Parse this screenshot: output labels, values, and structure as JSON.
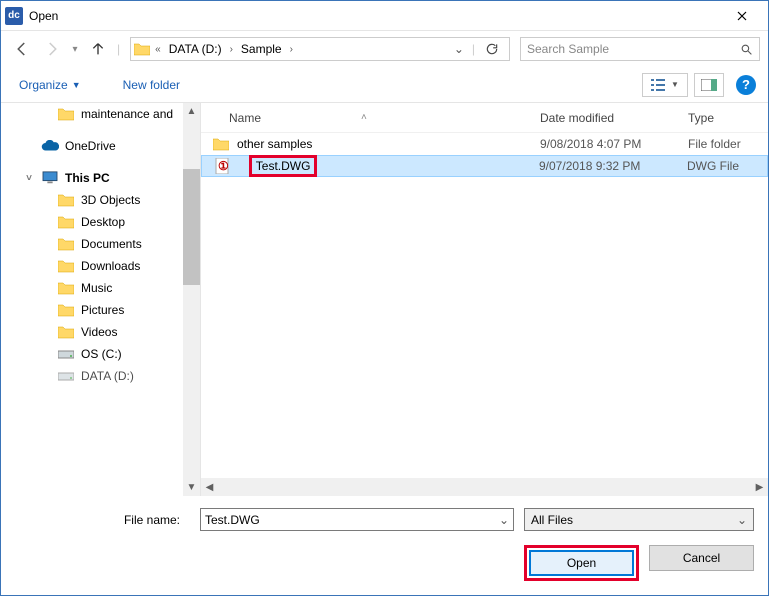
{
  "dialog": {
    "title": "Open",
    "app_icon_label": "dc"
  },
  "breadcrumb": {
    "prefix": "«",
    "items": [
      "DATA (D:)",
      "Sample"
    ]
  },
  "search": {
    "placeholder": "Search Sample"
  },
  "toolbar": {
    "organize": "Organize",
    "new_folder": "New folder"
  },
  "tree": {
    "items": [
      {
        "name": "maintenance and",
        "icon": "folder",
        "indent": 2
      },
      {
        "name": "",
        "icon": "",
        "indent": 0,
        "spacer": true
      },
      {
        "name": "OneDrive",
        "icon": "onedrive",
        "indent": 1,
        "bold": false,
        "expander": " "
      },
      {
        "name": "",
        "icon": "",
        "indent": 0,
        "spacer": true
      },
      {
        "name": "This PC",
        "icon": "thispc",
        "indent": 1,
        "bold": true,
        "expander": "v"
      },
      {
        "name": "3D Objects",
        "icon": "folder",
        "indent": 2
      },
      {
        "name": "Desktop",
        "icon": "folder",
        "indent": 2
      },
      {
        "name": "Documents",
        "icon": "folder",
        "indent": 2
      },
      {
        "name": "Downloads",
        "icon": "folder",
        "indent": 2
      },
      {
        "name": "Music",
        "icon": "folder",
        "indent": 2
      },
      {
        "name": "Pictures",
        "icon": "folder",
        "indent": 2
      },
      {
        "name": "Videos",
        "icon": "folder",
        "indent": 2
      },
      {
        "name": "OS (C:)",
        "icon": "drive",
        "indent": 2
      },
      {
        "name": "DATA (D:)",
        "icon": "drive",
        "indent": 2,
        "cut": true
      }
    ]
  },
  "columns": {
    "name": "Name",
    "date": "Date modified",
    "type": "Type"
  },
  "files": [
    {
      "name": "other samples",
      "date": "9/08/2018 4:07 PM",
      "type": "File folder",
      "icon": "folder",
      "selected": false,
      "highlight": false
    },
    {
      "name": "Test.DWG",
      "date": "9/07/2018 9:32 PM",
      "type": "DWG File",
      "icon": "dwg",
      "selected": true,
      "highlight": true
    }
  ],
  "footer": {
    "filename_label": "File name:",
    "filename_value": "Test.DWG",
    "filter": "All Files",
    "open": "Open",
    "cancel": "Cancel"
  },
  "annotation": {
    "step": "①"
  }
}
